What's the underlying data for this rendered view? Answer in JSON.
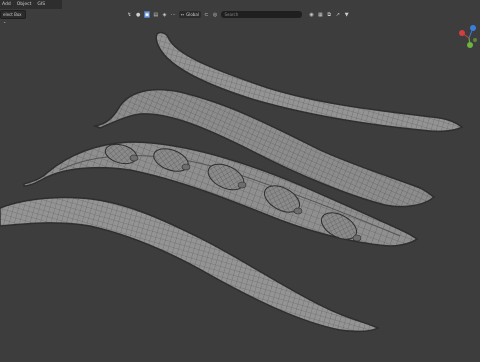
{
  "menu": {
    "add": "Add",
    "object": "Object",
    "gis": "GIS"
  },
  "toolbar": {
    "select_box_label": "elect Box",
    "orientation_label": "Global",
    "search_placeholder": "Search"
  },
  "icons": {
    "cursor": "cursor-icon",
    "select_mode": "select-mode-icon",
    "transform": "transform-icon",
    "pivot": "pivot-icon",
    "snap": "magnet-icon",
    "proportional": "proportional-edit-icon",
    "overlays": "overlay-icon",
    "view": "grid-view-icon",
    "filter": "filter-icon"
  },
  "colors": {
    "viewport_bg": "#3d3d3d",
    "gizmo_x": "#d33e3e",
    "gizmo_y": "#6fb43f",
    "gizmo_z": "#3a7de0",
    "active_tool": "#4d79b8",
    "mesh_fill": "#8e8e8e",
    "mesh_wire": "#5b5b5b"
  }
}
